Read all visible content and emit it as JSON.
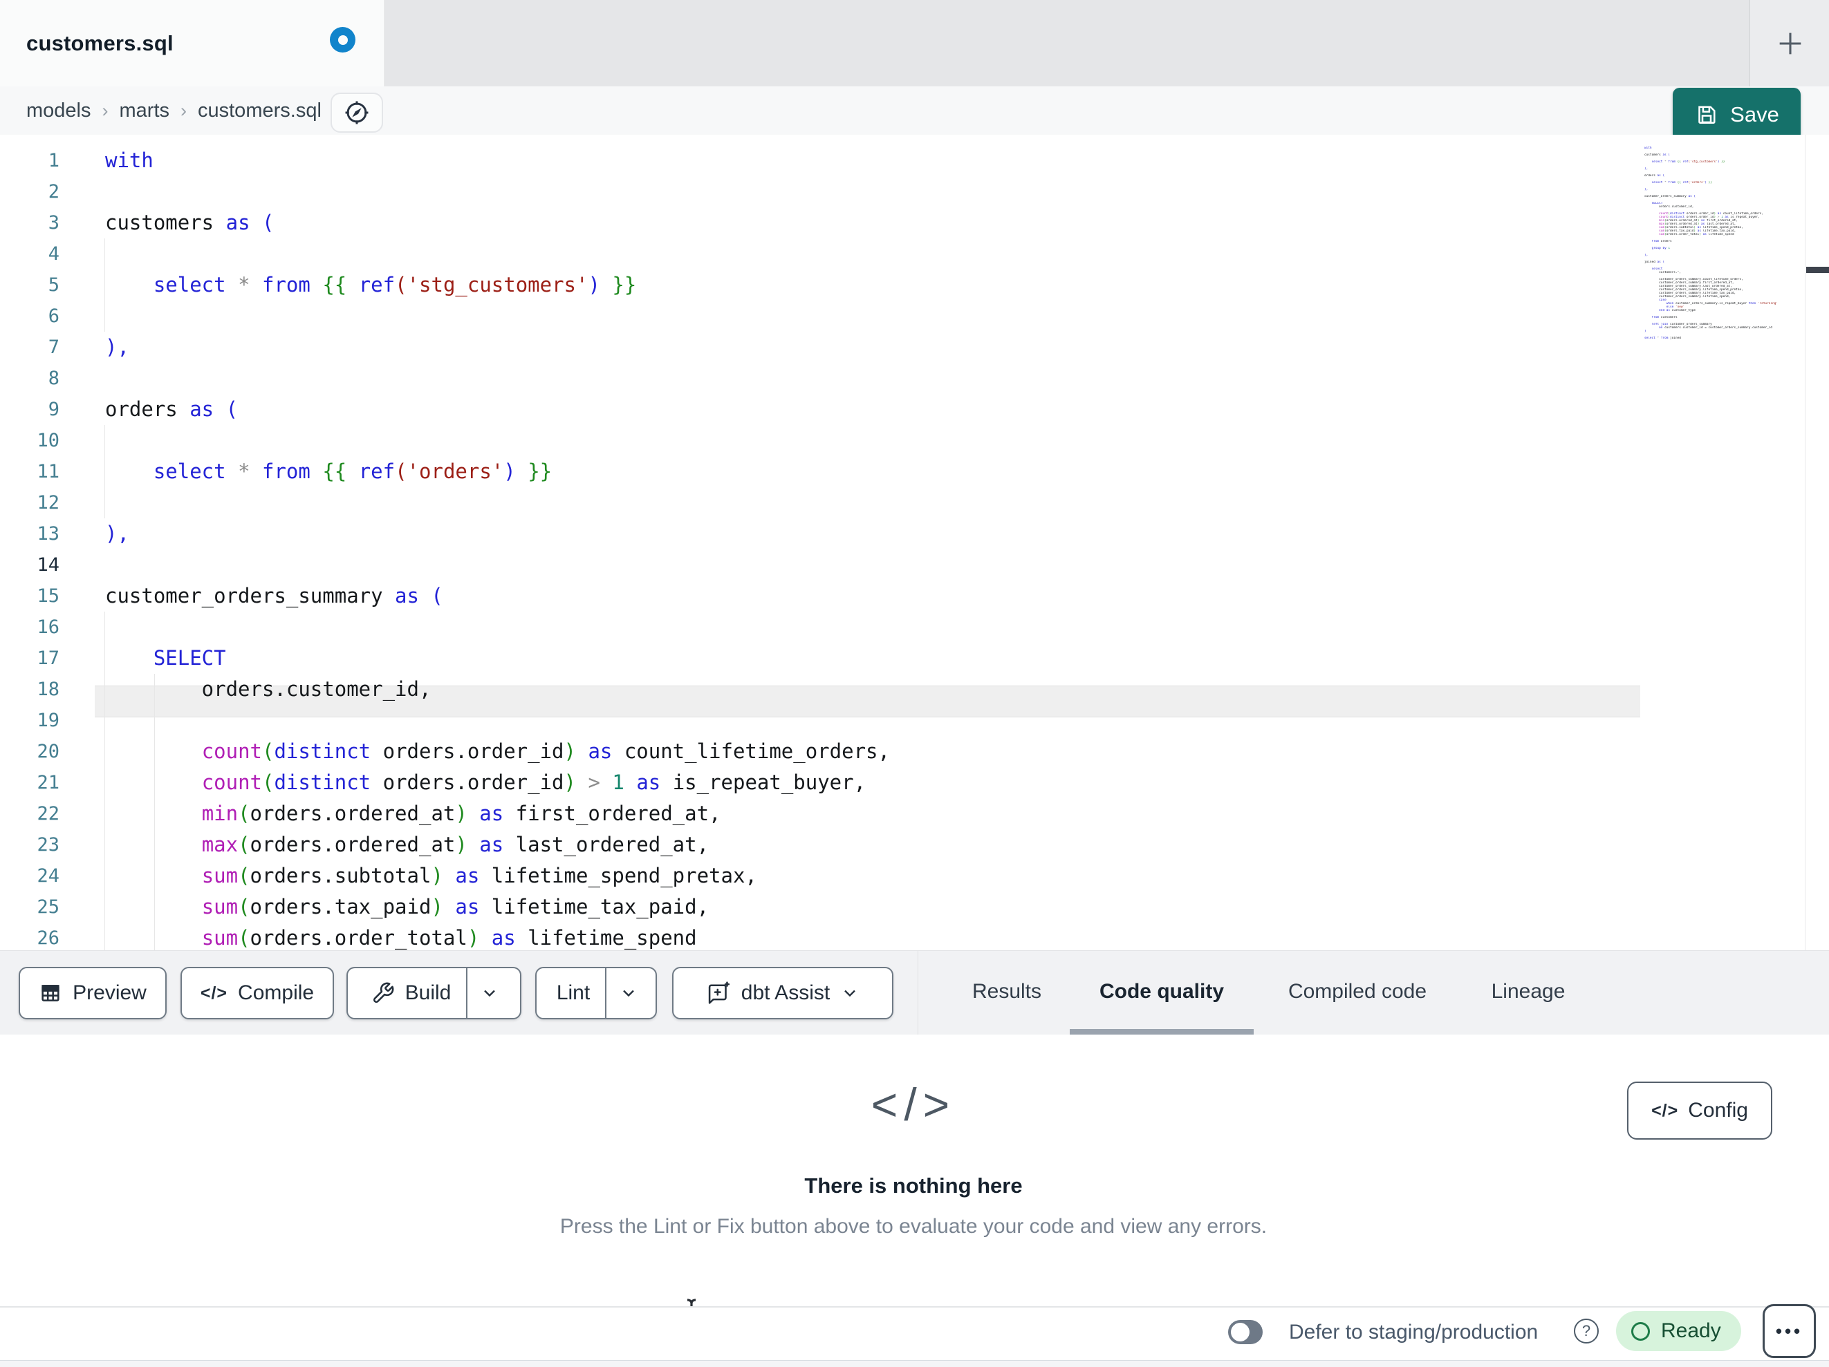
{
  "tab_bar": {
    "active_tab_title": "customers.sql",
    "modified": true,
    "new_tab_icon": "plus"
  },
  "breadcrumb": {
    "items": [
      "models",
      "marts",
      "customers.sql"
    ],
    "separator": "›"
  },
  "save": {
    "label": "Save"
  },
  "editor": {
    "visible_line_count": 26,
    "active_line": 14,
    "file_lines": [
      [
        [
          "kw",
          "with"
        ]
      ],
      [],
      [
        [
          "id",
          "customers "
        ],
        [
          "kw",
          "as ("
        ]
      ],
      [],
      [
        [
          "id",
          "    "
        ],
        [
          "kw",
          "select"
        ],
        [
          "id",
          " "
        ],
        [
          "op",
          "*"
        ],
        [
          "id",
          " "
        ],
        [
          "kw",
          "from"
        ],
        [
          "id",
          " "
        ],
        [
          "grn",
          "{{"
        ],
        [
          "id",
          " "
        ],
        [
          "kw",
          "ref"
        ],
        [
          "str",
          "('stg_customers'"
        ],
        [
          "kw",
          ")"
        ],
        [
          "id",
          " "
        ],
        [
          "grn",
          "}}"
        ]
      ],
      [],
      [
        [
          "kw",
          "),"
        ]
      ],
      [],
      [
        [
          "id",
          "orders "
        ],
        [
          "kw",
          "as ("
        ]
      ],
      [],
      [
        [
          "id",
          "    "
        ],
        [
          "kw",
          "select"
        ],
        [
          "id",
          " "
        ],
        [
          "op",
          "*"
        ],
        [
          "id",
          " "
        ],
        [
          "kw",
          "from"
        ],
        [
          "id",
          " "
        ],
        [
          "grn",
          "{{"
        ],
        [
          "id",
          " "
        ],
        [
          "kw",
          "ref"
        ],
        [
          "str",
          "('orders'"
        ],
        [
          "kw",
          ")"
        ],
        [
          "id",
          " "
        ],
        [
          "grn",
          "}}"
        ]
      ],
      [],
      [
        [
          "kw",
          "),"
        ]
      ],
      [],
      [
        [
          "id",
          "customer_orders_summary "
        ],
        [
          "kw",
          "as ("
        ]
      ],
      [],
      [
        [
          "id",
          "    "
        ],
        [
          "kw",
          "SELECT"
        ]
      ],
      [
        [
          "id",
          "        orders.customer_id,"
        ]
      ],
      [],
      [
        [
          "id",
          "        "
        ],
        [
          "fn",
          "count"
        ],
        [
          "grn",
          "("
        ],
        [
          "kw",
          "distinct"
        ],
        [
          "id",
          " orders.order_id"
        ],
        [
          "grn",
          ")"
        ],
        [
          "id",
          " "
        ],
        [
          "kw",
          "as"
        ],
        [
          "id",
          " count_lifetime_orders,"
        ]
      ],
      [
        [
          "id",
          "        "
        ],
        [
          "fn",
          "count"
        ],
        [
          "grn",
          "("
        ],
        [
          "kw",
          "distinct"
        ],
        [
          "id",
          " orders.order_id"
        ],
        [
          "grn",
          ")"
        ],
        [
          "id",
          " "
        ],
        [
          "op",
          ">"
        ],
        [
          "id",
          " "
        ],
        [
          "num",
          "1"
        ],
        [
          "id",
          " "
        ],
        [
          "kw",
          "as"
        ],
        [
          "id",
          " is_repeat_buyer,"
        ]
      ],
      [
        [
          "id",
          "        "
        ],
        [
          "fn",
          "min"
        ],
        [
          "grn",
          "("
        ],
        [
          "id",
          "orders.ordered_at"
        ],
        [
          "grn",
          ")"
        ],
        [
          "id",
          " "
        ],
        [
          "kw",
          "as"
        ],
        [
          "id",
          " first_ordered_at,"
        ]
      ],
      [
        [
          "id",
          "        "
        ],
        [
          "fn",
          "max"
        ],
        [
          "grn",
          "("
        ],
        [
          "id",
          "orders.ordered_at"
        ],
        [
          "grn",
          ")"
        ],
        [
          "id",
          " "
        ],
        [
          "kw",
          "as"
        ],
        [
          "id",
          " last_ordered_at,"
        ]
      ],
      [
        [
          "id",
          "        "
        ],
        [
          "fn",
          "sum"
        ],
        [
          "grn",
          "("
        ],
        [
          "id",
          "orders.subtotal"
        ],
        [
          "grn",
          ")"
        ],
        [
          "id",
          " "
        ],
        [
          "kw",
          "as"
        ],
        [
          "id",
          " lifetime_spend_pretax,"
        ]
      ],
      [
        [
          "id",
          "        "
        ],
        [
          "fn",
          "sum"
        ],
        [
          "grn",
          "("
        ],
        [
          "id",
          "orders.tax_paid"
        ],
        [
          "grn",
          ")"
        ],
        [
          "id",
          " "
        ],
        [
          "kw",
          "as"
        ],
        [
          "id",
          " lifetime_tax_paid,"
        ]
      ],
      [
        [
          "id",
          "        "
        ],
        [
          "fn",
          "sum"
        ],
        [
          "grn",
          "("
        ],
        [
          "id",
          "orders.order_total"
        ],
        [
          "grn",
          ")"
        ],
        [
          "id",
          " "
        ],
        [
          "kw",
          "as"
        ],
        [
          "id",
          " lifetime_spend"
        ]
      ],
      [],
      [
        [
          "id",
          "    "
        ],
        [
          "kw",
          "from"
        ],
        [
          "id",
          " orders"
        ]
      ],
      [],
      [
        [
          "id",
          "    "
        ],
        [
          "kw",
          "group by"
        ],
        [
          "id",
          " "
        ],
        [
          "num",
          "1"
        ]
      ],
      [],
      [
        [
          "kw",
          "),"
        ]
      ],
      [],
      [
        [
          "id",
          "joined "
        ],
        [
          "kw",
          "as ("
        ]
      ],
      [],
      [
        [
          "id",
          "    "
        ],
        [
          "kw",
          "select"
        ]
      ],
      [
        [
          "id",
          "        customers."
        ],
        [
          "op",
          "*"
        ],
        [
          "id",
          ","
        ]
      ],
      [],
      [
        [
          "id",
          "        customer_orders_summary.count_lifetime_orders,"
        ]
      ],
      [
        [
          "id",
          "        customer_orders_summary.first_ordered_at,"
        ]
      ],
      [
        [
          "id",
          "        customer_orders_summary.last_ordered_at,"
        ]
      ],
      [
        [
          "id",
          "        customer_orders_summary.lifetime_spend_pretax,"
        ]
      ],
      [
        [
          "id",
          "        customer_orders_summary.lifetime_tax_paid,"
        ]
      ],
      [
        [
          "id",
          "        customer_orders_summary.lifetime_spend,"
        ]
      ],
      [
        [
          "id",
          "        "
        ],
        [
          "kw",
          "case"
        ]
      ],
      [
        [
          "id",
          "            "
        ],
        [
          "kw",
          "when"
        ],
        [
          "id",
          " customer_orders_summary.is_repeat_buyer "
        ],
        [
          "kw",
          "then"
        ],
        [
          "id",
          " "
        ],
        [
          "str",
          "'returning'"
        ]
      ],
      [
        [
          "id",
          "            "
        ],
        [
          "kw",
          "else"
        ],
        [
          "id",
          " "
        ],
        [
          "str",
          "'new'"
        ]
      ],
      [
        [
          "id",
          "        "
        ],
        [
          "kw",
          "end as"
        ],
        [
          "id",
          " customer_type"
        ]
      ],
      [],
      [
        [
          "id",
          "    "
        ],
        [
          "kw",
          "from"
        ],
        [
          "id",
          " customers"
        ]
      ],
      [],
      [
        [
          "id",
          "    "
        ],
        [
          "kw",
          "left join"
        ],
        [
          "id",
          " customer_orders_summary"
        ]
      ],
      [
        [
          "id",
          "        "
        ],
        [
          "kw",
          "on"
        ],
        [
          "id",
          " customers.customer_id = customer_orders_summary.customer_id"
        ]
      ],
      [
        [
          "kw",
          ")"
        ]
      ],
      [],
      [
        [
          "kw",
          "select"
        ],
        [
          "id",
          " "
        ],
        [
          "op",
          "*"
        ],
        [
          "id",
          " "
        ],
        [
          "kw",
          "from"
        ],
        [
          "id",
          " joined"
        ]
      ]
    ]
  },
  "toolbar": {
    "buttons": [
      {
        "label": "Preview",
        "icon": "table-icon"
      },
      {
        "label": "Compile",
        "icon": "code-icon"
      },
      {
        "label": "Build",
        "icon": "wrench-icon",
        "dropdown": true
      },
      {
        "label": "Lint",
        "dropdown": true
      },
      {
        "label": "dbt Assist",
        "icon": "assist-icon",
        "dropdown": true
      }
    ]
  },
  "panel_tabs": {
    "items": [
      {
        "label": "Results",
        "active": false
      },
      {
        "label": "Code quality",
        "active": true
      },
      {
        "label": "Compiled code",
        "active": false
      },
      {
        "label": "Lineage",
        "active": false
      }
    ]
  },
  "panel": {
    "empty_icon": "</>",
    "empty_title": "There is nothing here",
    "empty_subtitle": "Press the Lint or Fix button above to evaluate your code and view any errors.",
    "config_label": "Config",
    "config_icon": "</>"
  },
  "status_bar": {
    "defer_toggle_on": false,
    "defer_label": "Defer to staging/production",
    "status_label": "Ready",
    "menu_dots": "•••"
  },
  "colors": {
    "accent_teal": "#15716a",
    "modified_dot_blue": "#1184cb",
    "ready_badge_bg": "#d7f3dc",
    "ready_badge_green": "#1e7c49",
    "syntax_keyword": "#2323d6",
    "syntax_function": "#b01fb5",
    "syntax_paren": "#1f8a1f",
    "syntax_string": "#9c1f16",
    "syntax_number": "#15866c"
  }
}
